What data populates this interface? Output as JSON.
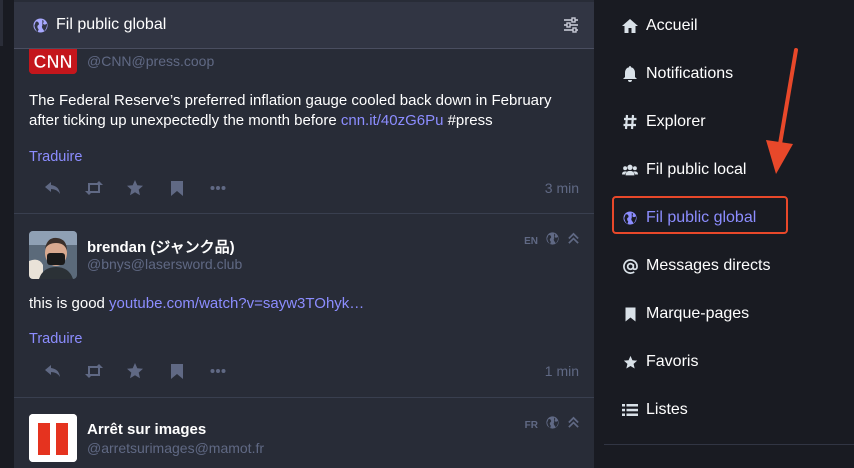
{
  "column": {
    "title": "Fil public global",
    "header_icon": "globe-icon",
    "settings_icon": "sliders-icon"
  },
  "statuses": [
    {
      "avatar": "cnn-logo",
      "display_name": "",
      "acct": "@CNN@press.coop",
      "content_text": "The Federal Reserve’s preferred inflation gauge cooled back down in February after ticking up unexpectedly the month before ",
      "link": "cnn.it/40zG6Pu",
      "content_after": " #press",
      "translate_label": "Traduire",
      "time": "3 min"
    },
    {
      "avatar": "person-photo",
      "display_name": "brendan (ジャンク品)",
      "acct": "@bnys@lasersword.club",
      "lang": "EN",
      "content_text": "this is good ",
      "link": "youtube.com/watch?v=sayw3TOhyk…",
      "content_after": "",
      "translate_label": "Traduire",
      "time": "1 min"
    },
    {
      "avatar": "arret-sur-images-logo",
      "display_name": "Arrêt sur images",
      "acct": "@arretsurimages@mamot.fr",
      "lang": "FR"
    }
  ],
  "actions": [
    "reply-icon",
    "boost-icon",
    "star-icon",
    "bookmark-icon",
    "more-icon"
  ],
  "sidebar": {
    "items": [
      {
        "label": "Accueil",
        "icon": "home-icon"
      },
      {
        "label": "Notifications",
        "icon": "bell-icon"
      },
      {
        "label": "Explorer",
        "icon": "hashtag-icon"
      },
      {
        "label": "Fil public local",
        "icon": "users-icon"
      },
      {
        "label": "Fil public global",
        "icon": "globe-icon",
        "active": true
      },
      {
        "label": "Messages directs",
        "icon": "at-icon"
      },
      {
        "label": "Marque-pages",
        "icon": "bookmark-icon"
      },
      {
        "label": "Favoris",
        "icon": "star-icon"
      },
      {
        "label": "Listes",
        "icon": "list-icon"
      }
    ]
  },
  "colors": {
    "background": "#191b22",
    "column": "#282c37",
    "header": "#313543",
    "accent": "#8c8dff",
    "muted": "#606984",
    "annotation": "#e8482a"
  }
}
